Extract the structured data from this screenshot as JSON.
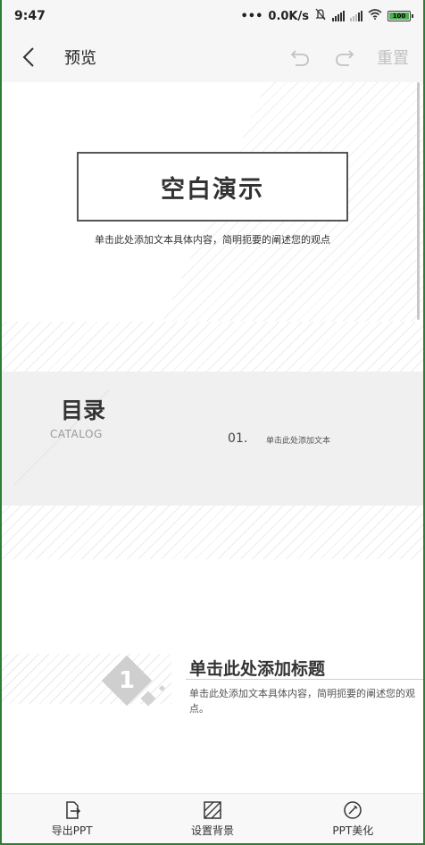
{
  "status": {
    "time": "9:47",
    "network_speed": "0.0K/s",
    "battery_level": 100
  },
  "toolbar": {
    "title": "预览",
    "reset_label": "重置",
    "icons": [
      "back-icon",
      "undo-icon",
      "redo-icon"
    ]
  },
  "slides": {
    "cover": {
      "title": "空白演示",
      "subtitle": "单击此处添加文本具体内容，简明扼要的阐述您的观点"
    },
    "toc": {
      "title": "目录",
      "subtitle": "CATALOG",
      "item_number": "01.",
      "item_text": "单击此处添加文本"
    },
    "section": {
      "number": "1",
      "title": "单击此处添加标题",
      "body": "单击此处添加文本具体内容，简明扼要的阐述您的观点。"
    }
  },
  "bottom_bar": {
    "export_label": "导出PPT",
    "background_label": "设置背景",
    "beautify_label": "PPT美化"
  },
  "colors": {
    "accent": "#4caf50",
    "disabled": "#c2c2c2",
    "frame": "#2e7d32"
  }
}
